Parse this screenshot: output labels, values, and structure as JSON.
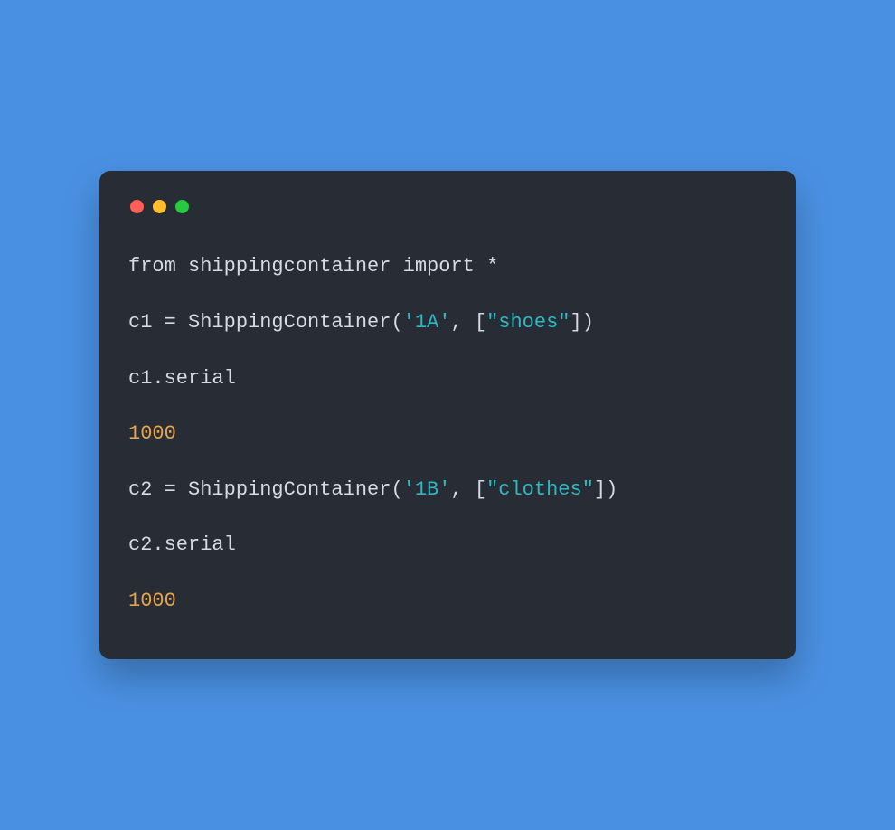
{
  "window": {
    "buttons": [
      "close",
      "minimize",
      "zoom"
    ]
  },
  "code": {
    "lines": [
      [
        {
          "cls": "tok-kw",
          "text": "from"
        },
        {
          "cls": "tok-plain",
          "text": " shippingcontainer "
        },
        {
          "cls": "tok-kw",
          "text": "import"
        },
        {
          "cls": "tok-plain",
          "text": " *"
        }
      ],
      [],
      [
        {
          "cls": "tok-plain",
          "text": "c1 = ShippingContainer("
        },
        {
          "cls": "tok-str",
          "text": "'1A'"
        },
        {
          "cls": "tok-plain",
          "text": ", ["
        },
        {
          "cls": "tok-str",
          "text": "\"shoes\""
        },
        {
          "cls": "tok-plain",
          "text": "])"
        }
      ],
      [],
      [
        {
          "cls": "tok-plain",
          "text": "c1.serial"
        }
      ],
      [],
      [
        {
          "cls": "tok-num",
          "text": "1000"
        }
      ],
      [],
      [
        {
          "cls": "tok-plain",
          "text": "c2 = ShippingContainer("
        },
        {
          "cls": "tok-str",
          "text": "'1B'"
        },
        {
          "cls": "tok-plain",
          "text": ", ["
        },
        {
          "cls": "tok-str",
          "text": "\"clothes\""
        },
        {
          "cls": "tok-plain",
          "text": "])"
        }
      ],
      [],
      [
        {
          "cls": "tok-plain",
          "text": "c2.serial"
        }
      ],
      [],
      [
        {
          "cls": "tok-num",
          "text": "1000"
        }
      ]
    ]
  }
}
